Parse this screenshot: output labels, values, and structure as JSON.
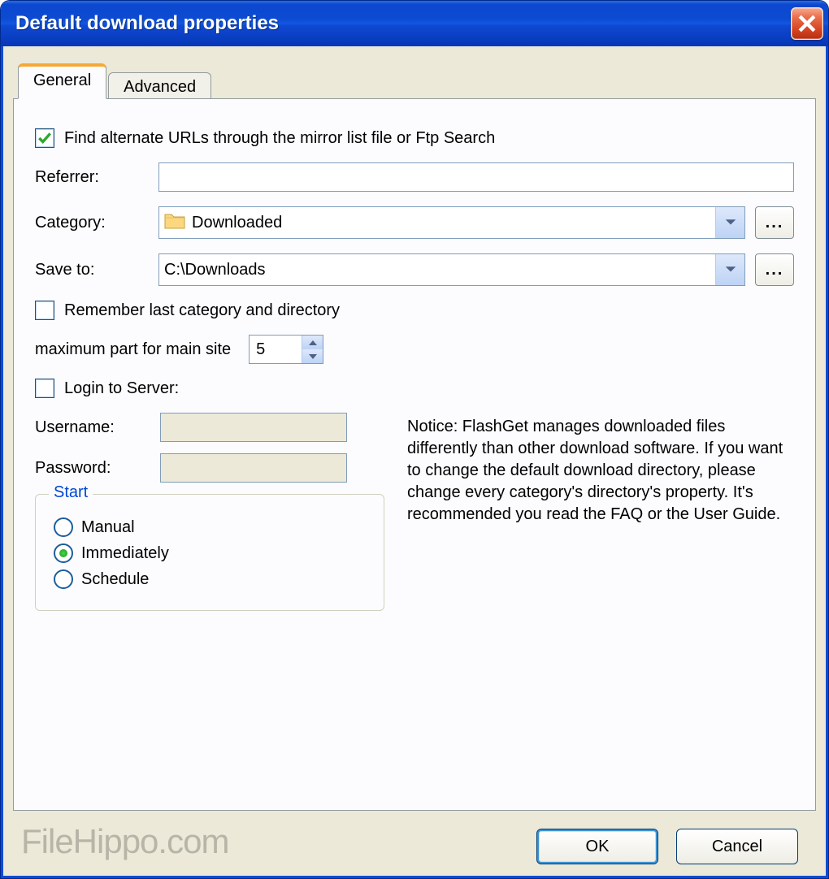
{
  "window": {
    "title": "Default download properties"
  },
  "tabs": {
    "general": "General",
    "advanced": "Advanced"
  },
  "general": {
    "find_alternate_label": "Find alternate URLs through the mirror list file or Ftp Search",
    "find_alternate_checked": true,
    "referrer_label": "Referrer:",
    "referrer_value": "",
    "category_label": "Category:",
    "category_value": "Downloaded",
    "browse_label": "...",
    "saveto_label": "Save to:",
    "saveto_value": "C:\\Downloads",
    "remember_label": "Remember last category and directory",
    "remember_checked": false,
    "max_part_label": "maximum part for main site",
    "max_part_value": "5",
    "login_label": "Login to Server:",
    "login_checked": false,
    "username_label": "Username:",
    "username_value": "",
    "password_label": "Password:",
    "password_value": "",
    "start_group": "Start",
    "radio_manual": "Manual",
    "radio_immediately": "Immediately",
    "radio_schedule": "Schedule",
    "start_selected": "immediately",
    "notice": "Notice: FlashGet manages downloaded files differently than other download software. If you want to change the default download directory, please change every category's directory's property. It's recommended you read the FAQ or the User Guide."
  },
  "buttons": {
    "ok": "OK",
    "cancel": "Cancel"
  },
  "watermark": "FileHippo.com"
}
